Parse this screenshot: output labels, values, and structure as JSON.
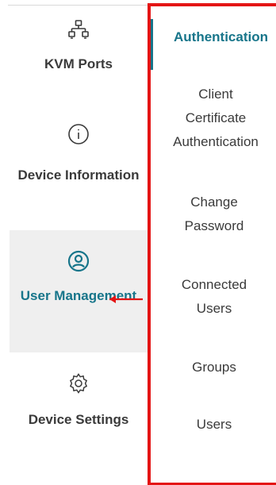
{
  "colors": {
    "accent": "#17758a",
    "text": "#3a3a3a",
    "selected_bg": "#efefef",
    "annotation_red": "#e41414"
  },
  "left_nav": {
    "items": [
      {
        "icon": "network-ports-icon",
        "label": "KVM Ports",
        "selected": false
      },
      {
        "icon": "info-circle-icon",
        "label": "Device Information",
        "selected": false
      },
      {
        "icon": "user-circle-icon",
        "label": "User Management",
        "selected": true
      },
      {
        "icon": "gear-icon",
        "label": "Device Settings",
        "selected": false
      }
    ]
  },
  "submenu": {
    "items": [
      {
        "label": "Authentication",
        "selected": true
      },
      {
        "label": "Client Certificate Authentication",
        "selected": false
      },
      {
        "label": "Change Password",
        "selected": false
      },
      {
        "label": "Connected Users",
        "selected": false
      },
      {
        "label": "Groups",
        "selected": false
      },
      {
        "label": "Users",
        "selected": false
      }
    ]
  },
  "annotation": {
    "icon": "left-arrow-icon"
  }
}
